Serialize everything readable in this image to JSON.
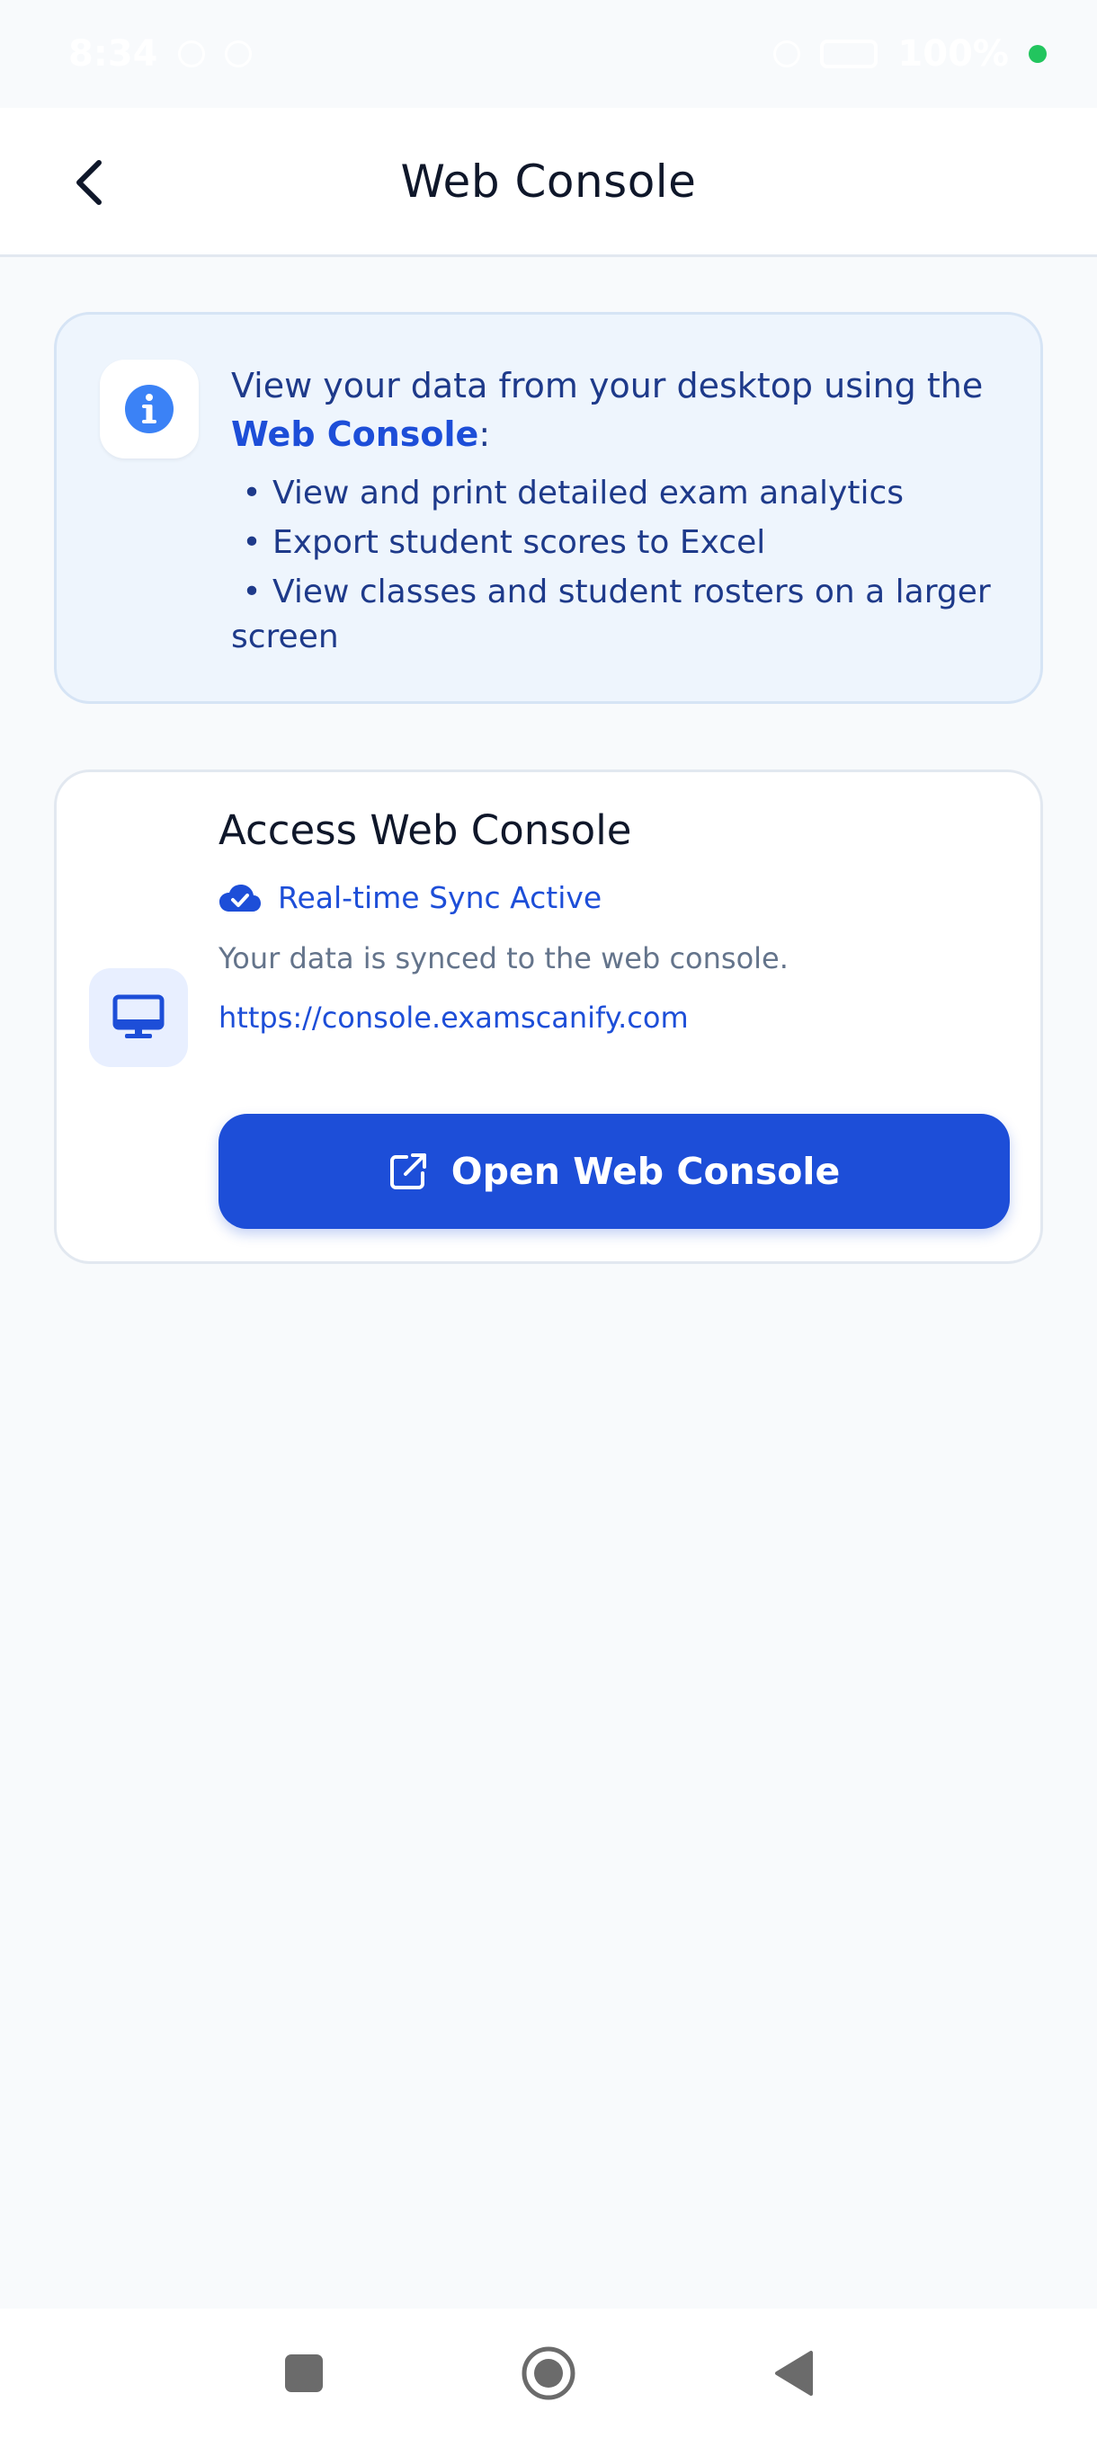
{
  "status_bar": {
    "time": "8:34",
    "battery": "100%",
    "dot_color": "#22c55e"
  },
  "header": {
    "title": "Web Console",
    "back_icon": "chevron-left-icon"
  },
  "info_card": {
    "icon": "info-icon",
    "intro_prefix": "View your data from your desktop using the ",
    "intro_emphasis": "Web Console",
    "intro_suffix": ":",
    "bullets": [
      "View and print detailed exam analytics",
      "Export student scores to Excel",
      "View classes and student rosters on a larger screen"
    ]
  },
  "access_card": {
    "icon": "monitor-icon",
    "title": "Access Web Console",
    "sync_icon": "cloud-check-icon",
    "sync_label": "Real-time Sync Active",
    "synced_text": "Your data is synced to the web console.",
    "url": "https://console.examscanify.com",
    "button_icon": "external-link-icon",
    "button_label": "Open Web Console"
  },
  "nav_bar": {
    "items": [
      "square-icon",
      "home-circle-icon",
      "back-triangle-icon"
    ]
  },
  "colors": {
    "accent": "#1d4ed8",
    "info_bg": "#eef5fd",
    "page_bg": "#f8fafc"
  }
}
